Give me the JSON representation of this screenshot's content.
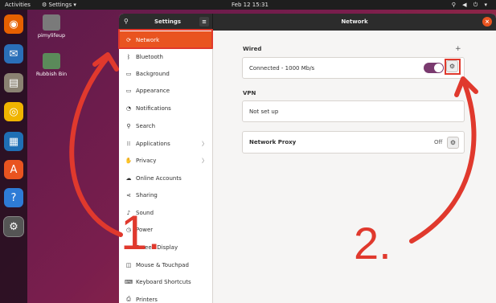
{
  "topbar": {
    "activities": "Activities",
    "app_menu": "⚙ Settings ▾",
    "clock": "Feb 12  15:31",
    "tray": "⚲ ◀ ⏻ ▾"
  },
  "desktop": [
    {
      "label": "pimylifeup"
    },
    {
      "label": "Rubbish Bin"
    }
  ],
  "dock": [
    {
      "icon": "firefox-icon",
      "glyph": "◉",
      "color": "#e66000"
    },
    {
      "icon": "thunderbird-icon",
      "glyph": "✉",
      "color": "#2a6fb8"
    },
    {
      "icon": "files-icon",
      "glyph": "▤",
      "color": "#8a8272"
    },
    {
      "icon": "rhythmbox-icon",
      "glyph": "◎",
      "color": "#f0b400"
    },
    {
      "icon": "writer-icon",
      "glyph": "▦",
      "color": "#1f6fb5"
    },
    {
      "icon": "software-icon",
      "glyph": "A",
      "color": "#e95420"
    },
    {
      "icon": "help-icon",
      "glyph": "?",
      "color": "#2e7bd6"
    },
    {
      "icon": "settings-icon",
      "glyph": "⚙",
      "color": "#555555"
    }
  ],
  "window": {
    "left_title": "Settings",
    "right_title": "Network",
    "menu_glyph": "≡",
    "search_glyph": "⚲",
    "close_glyph": "×"
  },
  "sidebar": {
    "items": [
      {
        "label": "Network",
        "icon": "⟳"
      },
      {
        "label": "Bluetooth",
        "icon": "ᛒ"
      },
      {
        "label": "Background",
        "icon": "▭"
      },
      {
        "label": "Appearance",
        "icon": "▭"
      },
      {
        "label": "Notifications",
        "icon": "◔"
      },
      {
        "label": "Search",
        "icon": "⚲"
      },
      {
        "label": "Applications",
        "icon": "⁞⁞",
        "chevron": "〉"
      },
      {
        "label": "Privacy",
        "icon": "✋",
        "chevron": "〉"
      },
      {
        "label": "Online Accounts",
        "icon": "☁"
      },
      {
        "label": "Sharing",
        "icon": "⋖"
      },
      {
        "label": "Sound",
        "icon": "♪"
      },
      {
        "label": "Power",
        "icon": "◷"
      },
      {
        "label": "Screen Display",
        "icon": "▭"
      },
      {
        "label": "Mouse & Touchpad",
        "icon": "◫"
      },
      {
        "label": "Keyboard Shortcuts",
        "icon": "⌨"
      },
      {
        "label": "Printers",
        "icon": "⎙"
      }
    ]
  },
  "network": {
    "wired_label": "Wired",
    "add_glyph": "+",
    "wired_status": "Connected - 1000 Mb/s",
    "vpn_label": "VPN",
    "vpn_status": "Not set up",
    "proxy_label": "Network Proxy",
    "proxy_state": "Off",
    "gear_glyph": "⚙"
  },
  "annotations": {
    "step1": "1.",
    "step2": "2.",
    "color": "#e0392d"
  }
}
